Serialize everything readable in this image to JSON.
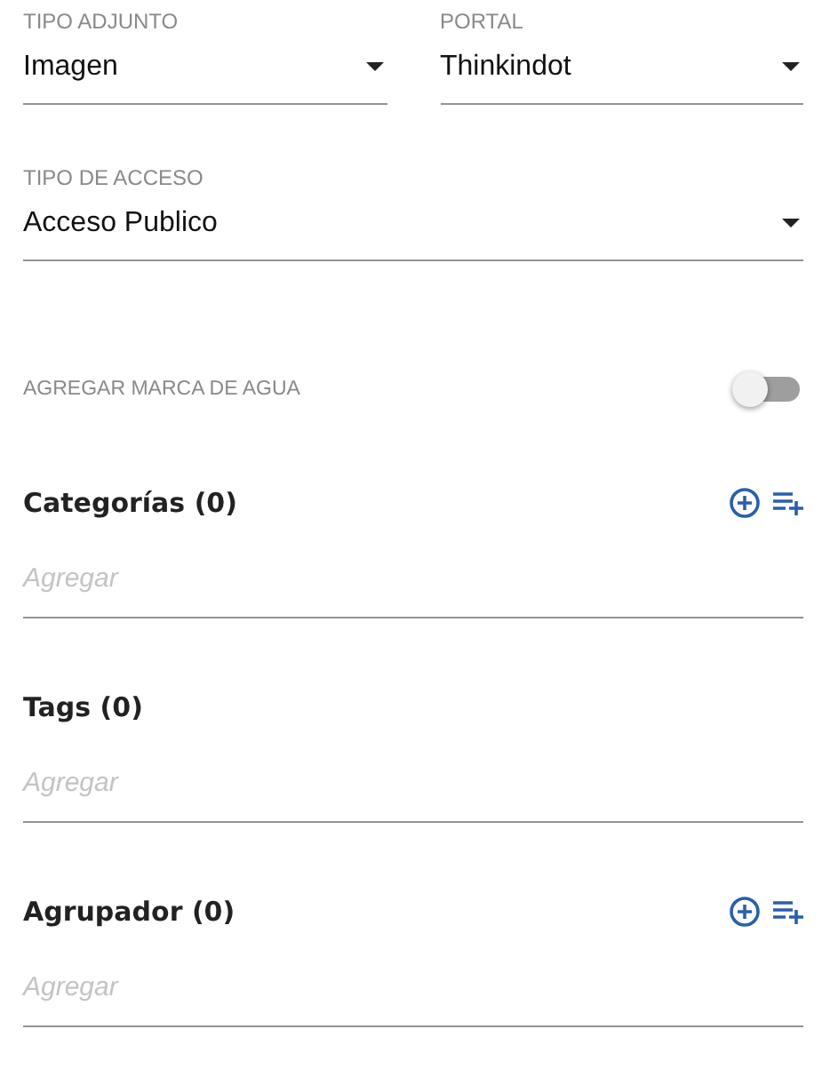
{
  "selects_row": [
    {
      "label": "TIPO ADJUNTO",
      "value": "Imagen"
    },
    {
      "label": "PORTAL",
      "value": "Thinkindot"
    }
  ],
  "access_select": {
    "label": "TIPO DE ACCESO",
    "value": "Acceso Publico"
  },
  "watermark_toggle": {
    "label": "AGREGAR MARCA DE AGUA",
    "on": false
  },
  "sections": [
    {
      "title": "Categorías (0)",
      "placeholder": "Agregar",
      "actions": true
    },
    {
      "title": "Tags (0)",
      "placeholder": "Agregar",
      "actions": false
    },
    {
      "title": "Agrupador (0)",
      "placeholder": "Agregar",
      "actions": true
    }
  ]
}
